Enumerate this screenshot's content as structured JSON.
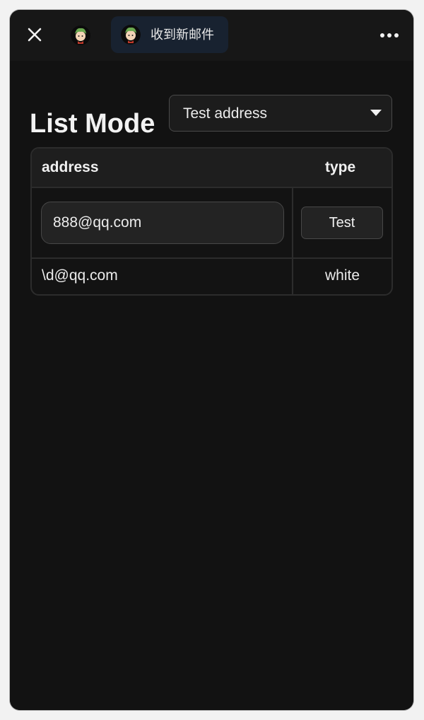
{
  "header": {
    "tab": {
      "label": "收到新邮件"
    }
  },
  "main": {
    "title": "List Mode",
    "mode_select": {
      "value": "Test address"
    },
    "table": {
      "columns": [
        "address",
        "type"
      ],
      "input_row": {
        "address_value": "888@qq.com",
        "action_label": "Test"
      },
      "rows": [
        {
          "address": "\\d@qq.com",
          "type": "white"
        }
      ]
    }
  }
}
